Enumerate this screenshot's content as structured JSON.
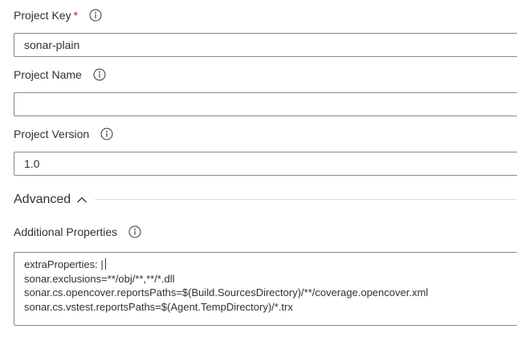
{
  "project_key": {
    "label": "Project Key",
    "required_marker": "*",
    "value": "sonar-plain"
  },
  "project_name": {
    "label": "Project Name",
    "value": ""
  },
  "project_version": {
    "label": "Project Version",
    "value": "1.0"
  },
  "advanced": {
    "label": "Advanced",
    "expanded": true
  },
  "additional_properties": {
    "label": "Additional Properties",
    "lines": [
      "extraProperties: |",
      "sonar.exclusions=**/obj/**,**/*.dll",
      "sonar.cs.opencover.reportsPaths=$(Build.SourcesDirectory)/**/coverage.opencover.xml",
      "sonar.cs.vstest.reportsPaths=$(Agent.TempDirectory)/*.trx"
    ]
  },
  "icons": {
    "info": "info-icon",
    "chevron": "chevron-up-icon"
  },
  "colors": {
    "text": "#323130",
    "required": "#a4262c",
    "border": "#8a8886",
    "divider": "#e1dfdd"
  }
}
